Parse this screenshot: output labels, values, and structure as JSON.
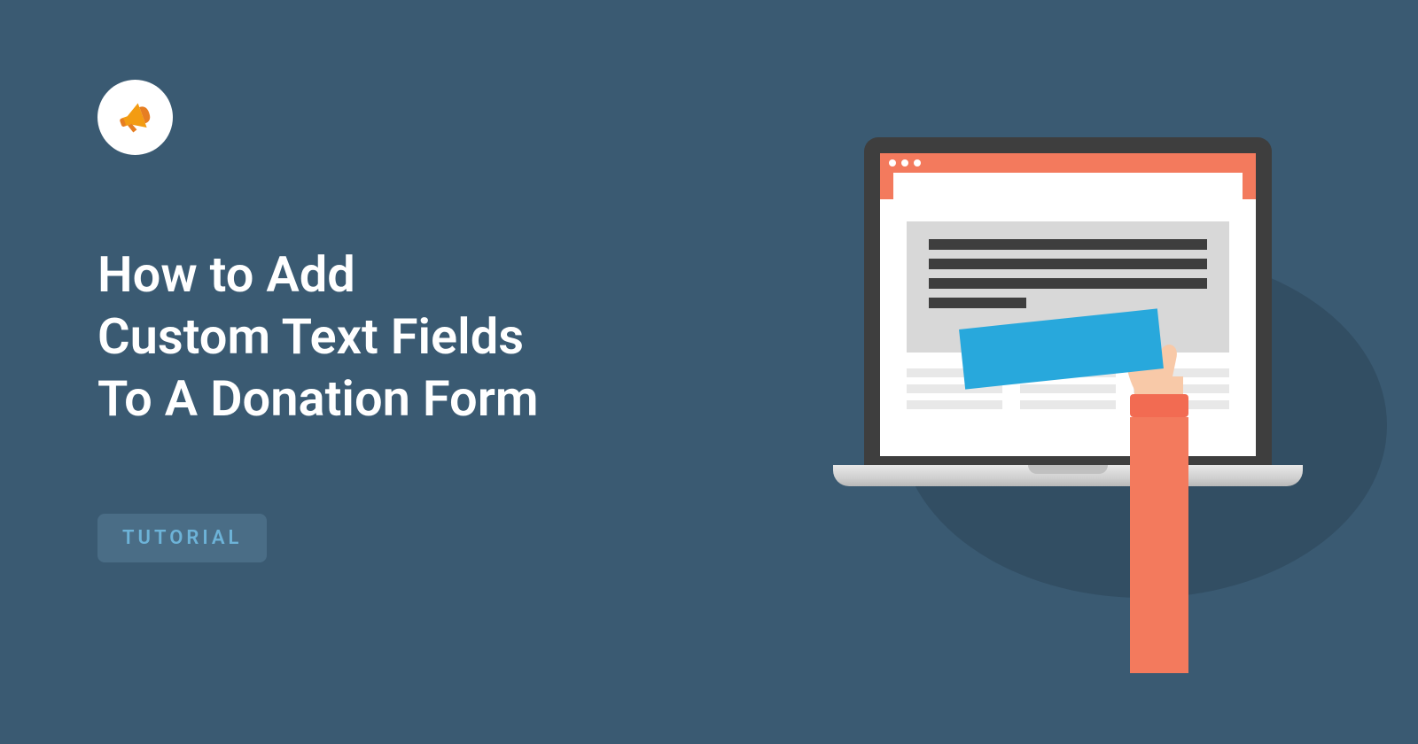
{
  "title_line1": "How to Add",
  "title_line2": "Custom Text Fields",
  "title_line3": "To A Donation Form",
  "badge_label": "TUTORIAL",
  "icon_name": "megaphone-icon"
}
